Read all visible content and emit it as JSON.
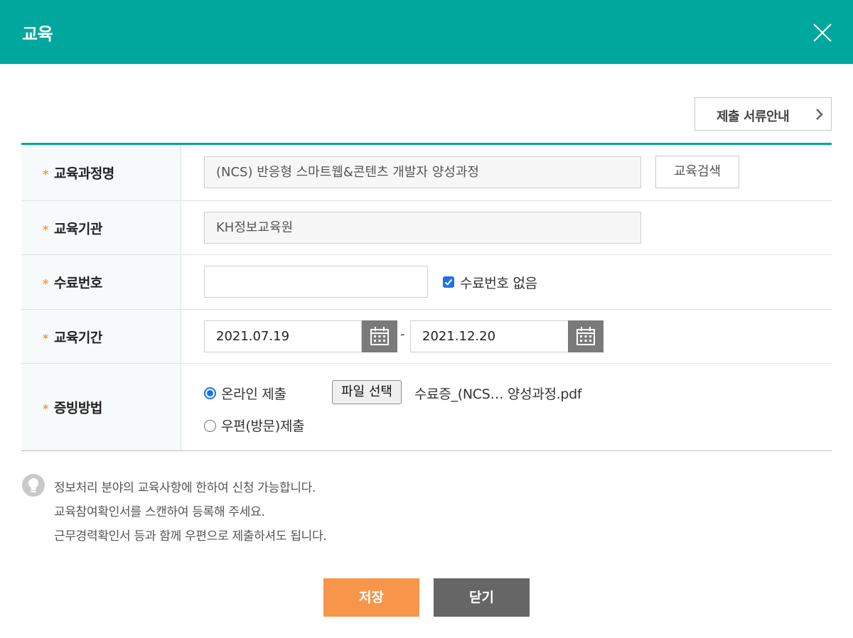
{
  "header": {
    "title": "교육",
    "close_icon": "close-icon"
  },
  "guide_button": {
    "label": "제출 서류안내",
    "icon": "chevron-right-icon"
  },
  "required_mark": "*",
  "colors": {
    "accent": "#00a79d",
    "required": "#f39a3f",
    "save": "#f7964a",
    "close": "#666666"
  },
  "form": {
    "course_name": {
      "label": "교육과정명",
      "value": "(NCS) 반응형 스마트웹&콘텐츠 개발자 양성과정",
      "search_button": "교육검색"
    },
    "institution": {
      "label": "교육기관",
      "value": "KH정보교육원"
    },
    "certificate_no": {
      "label": "수료번호",
      "value": "",
      "no_number_label": "수료번호 없음",
      "no_number_checked": true
    },
    "period": {
      "label": "교육기간",
      "start": "2021.07.19",
      "separator": "-",
      "end": "2021.12.20"
    },
    "proof_method": {
      "label": "증빙방법",
      "options": [
        {
          "label": "온라인 제출",
          "selected": true
        },
        {
          "label": "우편(방문)제출",
          "selected": false
        }
      ],
      "file_button": "파일 선택",
      "file_name": "수료증_(NCS… 양성과정.pdf"
    }
  },
  "notice": {
    "icon": "lightbulb-icon",
    "lines": [
      "정보처리 분야의 교육사항에 한하여 신청 가능합니다.",
      "교육참여확인서를 스캔하여 등록해 주세요.",
      "근무경력확인서 등과 함께 우편으로 제출하셔도 됩니다."
    ]
  },
  "actions": {
    "save": "저장",
    "close": "닫기"
  }
}
